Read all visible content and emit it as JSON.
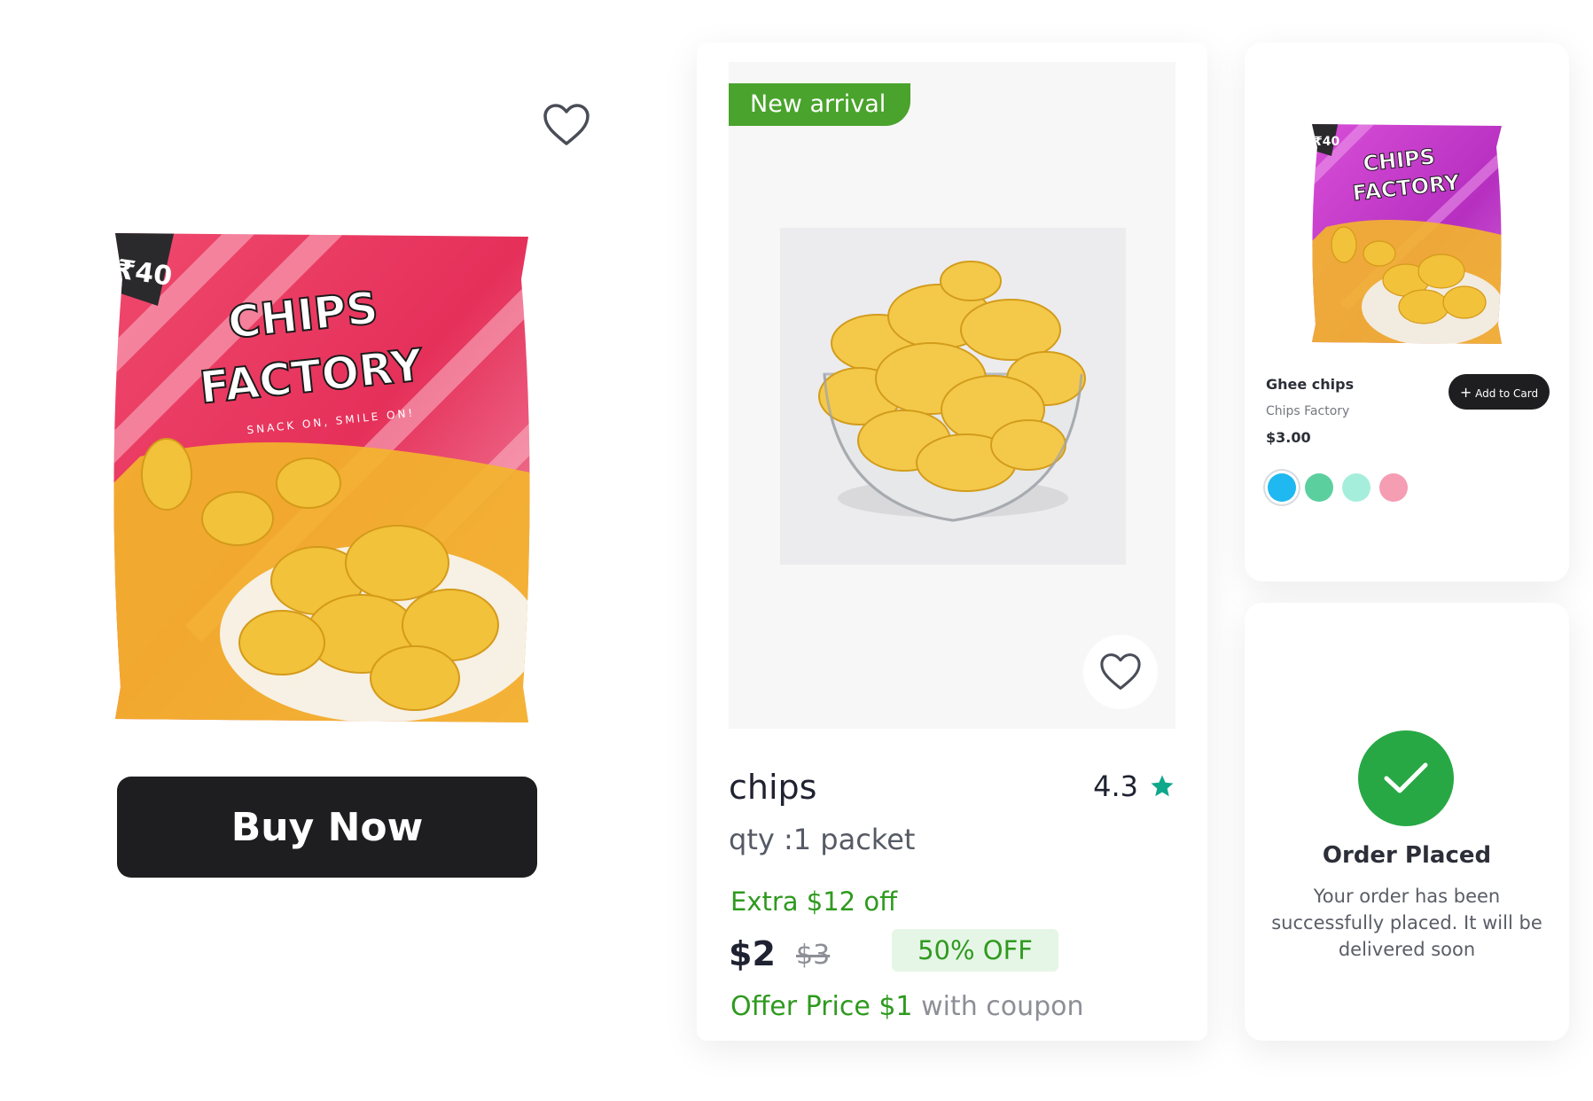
{
  "left": {
    "bag": {
      "price_tag": "₹40",
      "brand_line1": "CHIPS",
      "brand_line2": "FACTORY",
      "tagline": "SNACK ON, SMILE ON!"
    },
    "buy_label": "Buy Now",
    "favorite_icon": "heart-icon"
  },
  "card": {
    "badge": "New arrival",
    "title": "chips",
    "rating": "4.3",
    "rating_icon": "star-icon",
    "qty": "qty :1 packet",
    "extra_off": "Extra $12 off",
    "price": "$2",
    "old_price": "$3",
    "discount": "50% OFF",
    "offer_green": "Offer Price $1",
    "offer_gray": "with coupon",
    "favorite_icon": "heart-icon"
  },
  "mini": {
    "name": "Ghee chips",
    "brand": "Chips Factory",
    "price": "$3.00",
    "add_label": "Add to Card",
    "bag": {
      "price_tag": "₹40",
      "brand_line1": "CHIPS",
      "brand_line2": "FACTORY"
    },
    "swatches": [
      "#1fb8f0",
      "#5ccf9f",
      "#a6eedc",
      "#f59db3"
    ]
  },
  "order": {
    "title": "Order Placed",
    "message": "Your order has been successfully placed. It will be delivered soon",
    "icon": "check-icon"
  },
  "colors": {
    "accent_green": "#2f9a1f",
    "badge_green": "#4aa32c",
    "success_green": "#27a844",
    "dark_button": "#1e1e20",
    "star_teal": "#0fa88b"
  }
}
